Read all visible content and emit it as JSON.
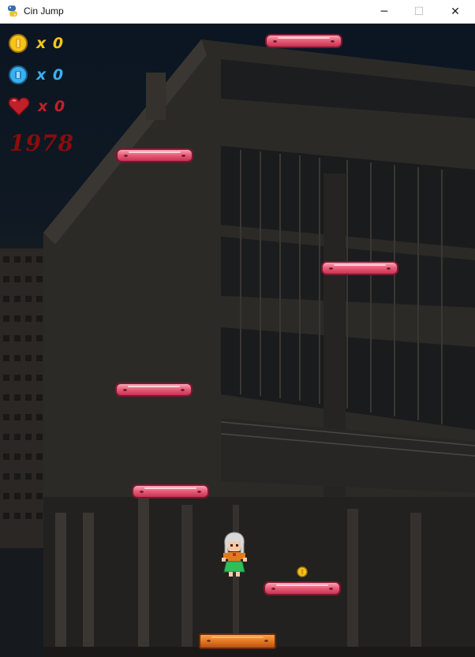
{
  "window": {
    "title": "Cin Jump",
    "app_icon": "python-icon",
    "controls": {
      "minimize": "─",
      "maximize": "☐",
      "close": "✕"
    }
  },
  "hud": {
    "coins": {
      "label": "x 0",
      "icon": "gold-coin-icon",
      "color": "#f5c518"
    },
    "gems": {
      "label": "x 0",
      "icon": "blue-gem-icon",
      "color": "#3ab0f0"
    },
    "lives": {
      "label": "x 0",
      "icon": "heart-icon",
      "color": "#c0202a"
    },
    "score": "1978",
    "score_color": "#8a0c0c"
  },
  "scene": {
    "background": "night-building",
    "platform_color": "#e8607a",
    "ground_platform_color": "#e47a22",
    "pickups": [
      "gold-coin"
    ],
    "character": "player-girl-sprite"
  }
}
